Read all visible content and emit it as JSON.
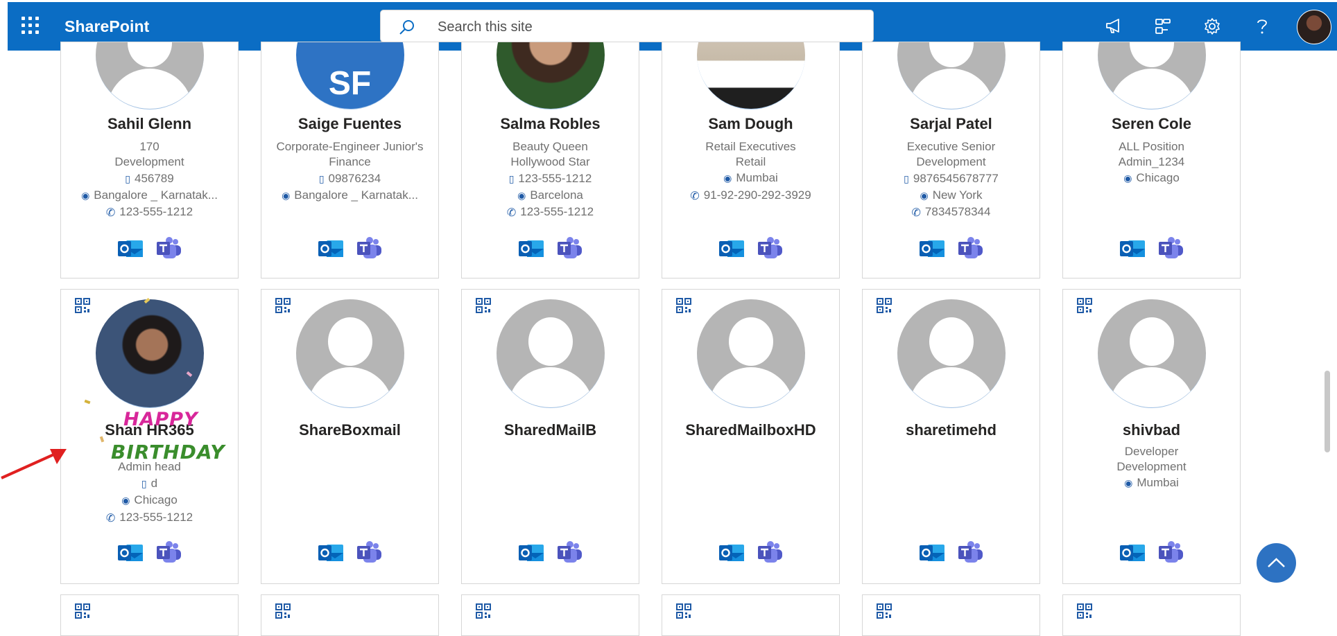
{
  "app": {
    "title": "SharePoint"
  },
  "search": {
    "placeholder": "Search this site"
  },
  "header_icons": [
    "waffle-icon",
    "megaphone-icon",
    "connections-icon",
    "gear-icon",
    "help-icon",
    "profile-avatar"
  ],
  "colors": {
    "suite_bar": "#0b6dc4",
    "accent": "#2d72c2",
    "text": "#252423",
    "muted": "#707070"
  },
  "row1": [
    {
      "name": "Sahil Glenn",
      "lines": [
        {
          "text": "170"
        },
        {
          "text": "Development"
        },
        {
          "icon": "phone-mobile-icon",
          "text": "456789"
        },
        {
          "icon": "location-icon",
          "text": "Bangalore _ Karnatak..."
        },
        {
          "icon": "phone-icon",
          "text": "123-555-1212"
        }
      ]
    },
    {
      "name": "Saige Fuentes",
      "initials": "SF",
      "lines": [
        {
          "text": "Corporate-Engineer Junior's"
        },
        {
          "text": "Finance"
        },
        {
          "icon": "phone-mobile-icon",
          "text": "09876234"
        },
        {
          "icon": "location-icon",
          "text": "Bangalore _ Karnatak..."
        }
      ]
    },
    {
      "name": "Salma Robles",
      "lines": [
        {
          "text": "Beauty Queen"
        },
        {
          "text": "Hollywood Star"
        },
        {
          "icon": "phone-mobile-icon",
          "text": "123-555-1212"
        },
        {
          "icon": "location-icon",
          "text": "Barcelona"
        },
        {
          "icon": "phone-icon",
          "text": "123-555-1212"
        }
      ]
    },
    {
      "name": "Sam Dough",
      "lines": [
        {
          "text": "Retail Executives"
        },
        {
          "text": "Retail"
        },
        {
          "icon": "location-icon",
          "text": "Mumbai"
        },
        {
          "icon": "phone-icon",
          "text": "91-92-290-292-3929"
        }
      ]
    },
    {
      "name": "Sarjal Patel",
      "lines": [
        {
          "text": "Executive Senior"
        },
        {
          "text": "Development"
        },
        {
          "icon": "phone-mobile-icon",
          "text": "9876545678777"
        },
        {
          "icon": "location-icon",
          "text": "New York"
        },
        {
          "icon": "phone-icon",
          "text": "7834578344"
        }
      ]
    },
    {
      "name": "Seren Cole",
      "lines": [
        {
          "text": "ALL Position"
        },
        {
          "text": "Admin_1234"
        },
        {
          "icon": "location-icon",
          "text": "Chicago"
        }
      ]
    }
  ],
  "row2": [
    {
      "name": "Shan HR365",
      "lines": [
        {
          "text": "Admin head"
        },
        {
          "icon": "phone-mobile-icon",
          "text": "d"
        },
        {
          "icon": "location-icon",
          "text": "Chicago"
        },
        {
          "icon": "phone-icon",
          "text": "123-555-1212"
        }
      ]
    },
    {
      "name": "ShareBoxmail",
      "lines": []
    },
    {
      "name": "SharedMailB",
      "lines": []
    },
    {
      "name": "SharedMailboxHD",
      "lines": []
    },
    {
      "name": "sharetimehd",
      "lines": []
    },
    {
      "name": "shivbad",
      "lines": [
        {
          "text": "Developer"
        },
        {
          "text": "Development"
        },
        {
          "icon": "location-icon",
          "text": "Mumbai"
        }
      ]
    }
  ],
  "birthday": {
    "line1": "HAPPY",
    "line2": "BIRTHDAY"
  },
  "card_actions": {
    "outlook_icon": "outlook-icon",
    "teams_icon": "teams-icon",
    "qr_icon": "qr-code-icon"
  }
}
